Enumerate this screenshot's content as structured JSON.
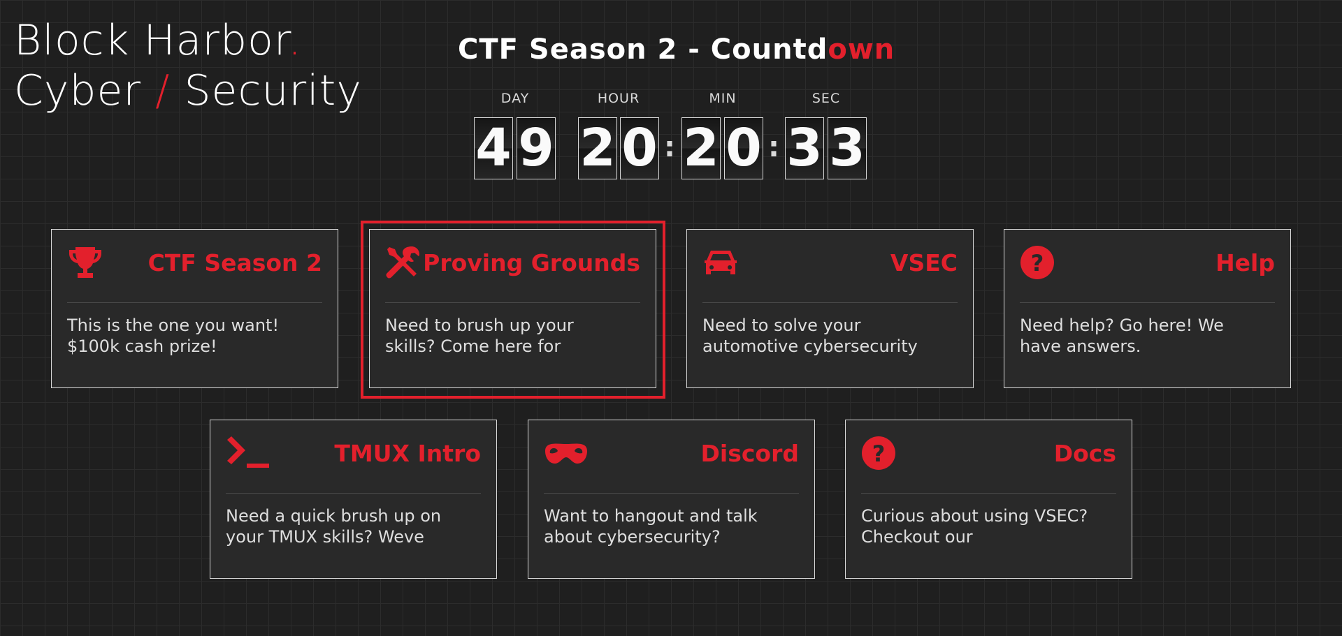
{
  "brand": {
    "line1": "Block Harbor",
    "dot": ".",
    "word2a": "Cyber",
    "slash": "/",
    "word2b": "Security"
  },
  "title": {
    "main": "CTF Season 2 - Countd",
    "accent": "own"
  },
  "countdown": {
    "labels": {
      "day": "DAY",
      "hour": "HOUR",
      "min": "MIN",
      "sec": "SEC"
    },
    "day": [
      "4",
      "9"
    ],
    "hour": [
      "2",
      "0"
    ],
    "min": [
      "2",
      "0"
    ],
    "sec": [
      "3",
      "3"
    ],
    "separator": ":"
  },
  "cards": [
    {
      "title": "CTF Season 2",
      "icon": "trophy-icon",
      "desc1": "This is the one you want!",
      "desc2": "$100k cash prize!"
    },
    {
      "title": "Proving Grounds",
      "icon": "tools-icon",
      "desc1": "Need to brush up your",
      "desc2": "skills? Come here for",
      "highlighted": true
    },
    {
      "title": "VSEC",
      "icon": "car-icon",
      "desc1": "Need to solve your",
      "desc2": "automotive cybersecurity"
    },
    {
      "title": "Help",
      "icon": "question-circle-icon",
      "desc1": "Need help? Go here! We",
      "desc2": "have answers."
    },
    {
      "title": "TMUX Intro",
      "icon": "terminal-icon",
      "desc1": "Need a quick brush up on",
      "desc2": "your TMUX skills? Weve"
    },
    {
      "title": "Discord",
      "icon": "mask-icon",
      "desc1": "Want to hangout and talk",
      "desc2": "about cybersecurity?"
    },
    {
      "title": "Docs",
      "icon": "question-circle-icon",
      "desc1": "Curious about using VSEC?",
      "desc2": "Checkout our"
    }
  ],
  "colors": {
    "accent": "#e3202c",
    "background": "#1f1f1f",
    "card": "#292929"
  }
}
